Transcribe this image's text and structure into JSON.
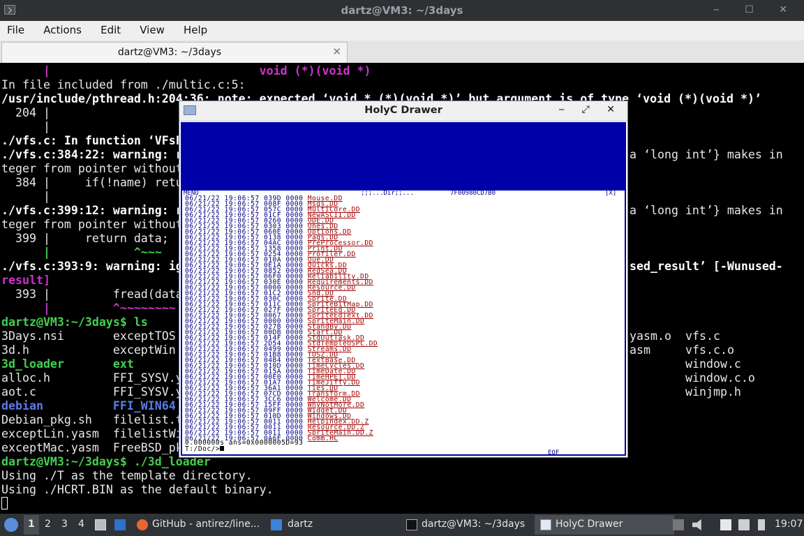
{
  "window": {
    "title": "dartz@VM3: ~/3days",
    "controls": "‒ ☐ ✕"
  },
  "menu": [
    "File",
    "Actions",
    "Edit",
    "View",
    "Help"
  ],
  "tab": {
    "label": "dartz@VM3: ~/3days",
    "close": "✕"
  },
  "terminal": {
    "lines": [
      "      |                              void (*)(void *)",
      "In file included from ./multic.c:5:",
      "/usr/include/pthread.h:204:36: note: expected ‘void * (*)(void *)’ but argument is of type ‘void (*)(void *)’",
      "  204 |",
      "      |",
      "./vfs.c: In function ‘VFsF",
      "./vfs.c:384:22: warning: r",
      "teger from pointer without",
      "  384 |     if(!name) retu",
      "      |",
      "./vfs.c:399:12: warning: r",
      "teger from pointer without",
      "  399 |     return data;",
      "      |            ^~~~",
      "./vfs.c:393:9: warning: ig",
      "result]",
      "  393 |         fread(data",
      "      |         ^~~~~~~~~",
      "dartz@VM3:~/3days$ ls",
      "3Days.nsi       exceptTOS",
      "3d.h            exceptWin",
      "3d_loader       ext",
      "alloc.h         FFI_SYSV.y",
      "aot.c           FFI_SYSV.y",
      "debian          FFI_WIN64",
      "Debian_pkg.sh   filelist.t",
      "exceptLin.yasm  filelistWi",
      "exceptMac.yasm  FreeBSD_pk",
      "dartz@VM3:~/3days$ ./3d_loader",
      "Using ./T as the template directory.",
      "Using ./HCRT.BIN as the default binary."
    ],
    "right": {
      "r1": "a ‘long int’} makes in",
      "r2": "a ‘long int’} makes in",
      "r3": "sed_result’ [-Wunused-",
      "ls1a": "yasm.o",
      "ls1b": "vfs.c",
      "ls2a": "asm",
      "ls2b": "vfs.c.o",
      "ls3": "window.c",
      "ls4": "window.c.o",
      "ls5": "winjmp.h"
    }
  },
  "holyc": {
    "title": "HolyC Drawer",
    "controls": "‒ ⤢ ✕",
    "menu_bar": "MENU",
    "dir_bar": ";;;...Dir;;...",
    "addr": "7F00980CD7B0",
    "close_tag": "[X]",
    "rows": [
      [
        "06/21/22",
        "19:06:57",
        "039D",
        "0000",
        "Mouse.DD"
      ],
      [
        "06/21/22",
        "19:06:57",
        "008F",
        "0000",
        "Msgs.DD"
      ],
      [
        "06/21/22",
        "19:06:57",
        "057C",
        "0000",
        "MultiCore.DD"
      ],
      [
        "06/21/22",
        "19:06:57",
        "01CF",
        "0000",
        "NewASCII.DD"
      ],
      [
        "06/21/22",
        "19:06:57",
        "0260",
        "0000",
        "ODE.DD"
      ],
      [
        "06/21/22",
        "19:06:57",
        "0303",
        "0000",
        "Ones.DD"
      ],
      [
        "06/21/22",
        "19:06:57",
        "060E",
        "0000",
        "Options.DD"
      ],
      [
        "06/21/22",
        "19:06:57",
        "0138",
        "0000",
        "Pags.DD"
      ],
      [
        "06/21/22",
        "19:06:57",
        "04AC",
        "0000",
        "PreProcessor.DD"
      ],
      [
        "06/21/22",
        "19:06:57",
        "1358",
        "0000",
        "Print.DD"
      ],
      [
        "06/21/22",
        "19:06:57",
        "0254",
        "0000",
        "Profiler.DD"
      ],
      [
        "06/21/22",
        "19:06:57",
        "010A",
        "0000",
        "Que.DD"
      ],
      [
        "06/21/22",
        "19:06:57",
        "0E1A",
        "0000",
        "Quicks.DD"
      ],
      [
        "06/21/22",
        "19:06:57",
        "0852",
        "0000",
        "RedSea.DD"
      ],
      [
        "06/21/22",
        "19:06:57",
        "06F0",
        "0000",
        "Reliability.DD"
      ],
      [
        "06/21/22",
        "19:06:57",
        "030E",
        "0000",
        "Requirements.DD"
      ],
      [
        "06/21/22",
        "19:06:57",
        "0000",
        "0000",
        "Resource.DD"
      ],
      [
        "06/21/22",
        "19:06:57",
        "01C2",
        "0000",
        "Snd.DD"
      ],
      [
        "06/21/22",
        "19:06:57",
        "030C",
        "0000",
        "Sprite.DD"
      ],
      [
        "06/21/22",
        "19:06:57",
        "011C",
        "0000",
        "SpriteBitMap.DD"
      ],
      [
        "06/21/22",
        "19:06:57",
        "027F",
        "0000",
        "SpriteEd.DD"
      ],
      [
        "06/21/22",
        "19:06:57",
        "0067",
        "0000",
        "SpriteEdText.DD"
      ],
      [
        "06/21/22",
        "19:06:57",
        "0000",
        "0000",
        "SpriteMain.DD"
      ],
      [
        "06/21/22",
        "19:06:57",
        "027B",
        "0000",
        "StandBy.DD"
      ],
      [
        "06/21/22",
        "19:06:57",
        "00DB",
        "0000",
        "Start.DD"
      ],
      [
        "06/21/22",
        "19:06:57",
        "014F",
        "0000",
        "StdOutTask.DD"
      ],
      [
        "06/21/22",
        "19:06:57",
        "2D54",
        "0000",
        "StdTempleOSPC.DD"
      ],
      [
        "06/21/22",
        "19:06:57",
        "0499",
        "0000",
        "Streams.DD"
      ],
      [
        "06/21/22",
        "19:06:57",
        "01B8",
        "0000",
        "TOSZ.DD"
      ],
      [
        "06/21/22",
        "19:06:57",
        "04B4",
        "0000",
        "TextBase.DD"
      ],
      [
        "06/21/22",
        "19:06:57",
        "010D",
        "0000",
        "TimeCycles.DD"
      ],
      [
        "06/21/22",
        "19:06:57",
        "015A",
        "0000",
        "TimeDate.DD"
      ],
      [
        "06/21/22",
        "19:06:57",
        "00E0",
        "0000",
        "TimeHPET.DD"
      ],
      [
        "06/21/22",
        "19:06:57",
        "01A7",
        "0000",
        "TimeJiffy.DD"
      ],
      [
        "06/21/22",
        "19:06:57",
        "36A1",
        "0000",
        "Ties.DD"
      ],
      [
        "06/21/22",
        "19:06:57",
        "07CD",
        "0000",
        "Transform.DD"
      ],
      [
        "06/21/22",
        "19:06:57",
        "3CC6",
        "0000",
        "Welcome.DD"
      ],
      [
        "06/21/22",
        "19:06:57",
        "15FF",
        "0000",
        "WhyNotMore.DD"
      ],
      [
        "06/21/22",
        "19:06:57",
        "09FF",
        "0000",
        "Widget.DD"
      ],
      [
        "06/21/22",
        "19:06:57",
        "010D",
        "0000",
        "Windows.DD"
      ],
      [
        "06/21/22",
        "19:06:57",
        "0011",
        "0000",
        "HelpIndex.DD.Z"
      ],
      [
        "06/21/22",
        "19:06:57",
        "0011",
        "0000",
        "Resource.DD.Z"
      ],
      [
        "06/21/22",
        "19:06:57",
        "0011",
        "0000",
        "SpriteMain.DD.Z"
      ],
      [
        "06/21/22",
        "19:06:57",
        "0A6F",
        "0000",
        "Comm.HC"
      ]
    ],
    "status": "0.000000s ans=0x0000005D=93",
    "prompt": "T:/Doc/>",
    "eof": "EOF"
  },
  "taskbar": {
    "workspaces": [
      "1",
      "2",
      "3",
      "4"
    ],
    "tasks": {
      "browser": "GitHub - antirez/line...",
      "files": "dartz",
      "terminal": "dartz@VM3: ~/3days",
      "holyc": "HolyC Drawer"
    },
    "clock": "19:07"
  }
}
